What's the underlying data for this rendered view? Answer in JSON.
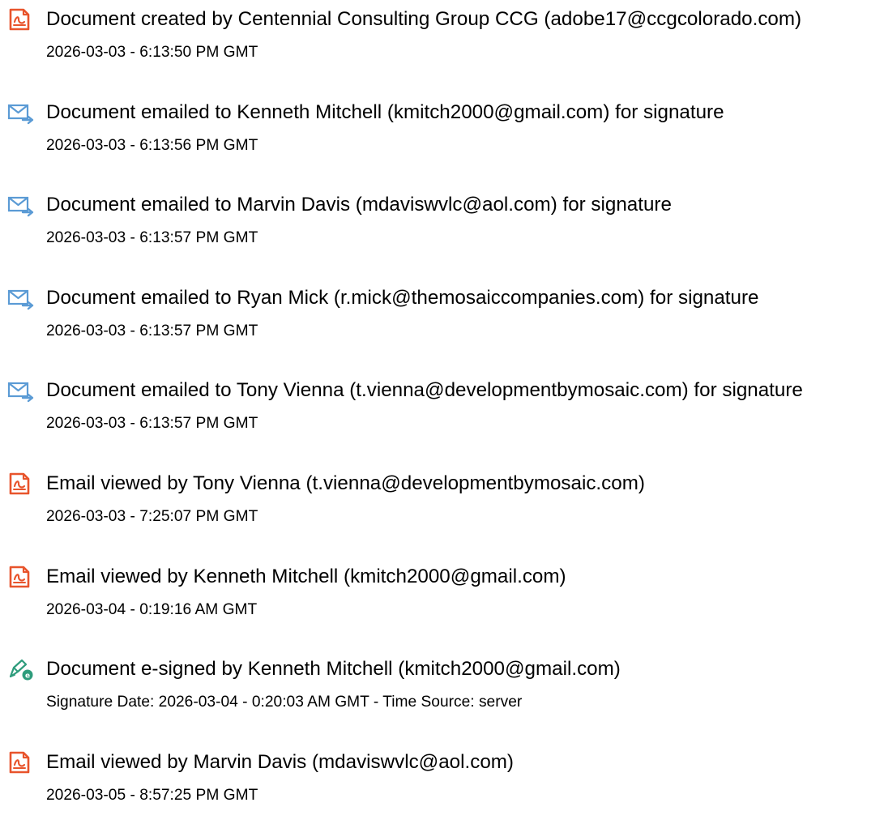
{
  "colors": {
    "document_icon": "#e8542c",
    "email_icon": "#5b9bd5",
    "signed_icon": "#2e9c7c",
    "text": "#000000"
  },
  "events": [
    {
      "icon": "document-icon",
      "title": "Document created by Centennial Consulting Group CCG (adobe17@ccgcolorado.com)",
      "detail": "2026-03-03 - 6:13:50 PM GMT"
    },
    {
      "icon": "email-send-icon",
      "title": "Document emailed to Kenneth Mitchell (kmitch2000@gmail.com) for signature",
      "detail": "2026-03-03 - 6:13:56 PM GMT"
    },
    {
      "icon": "email-send-icon",
      "title": "Document emailed to Marvin Davis (mdaviswvlc@aol.com) for signature",
      "detail": "2026-03-03 - 6:13:57 PM GMT"
    },
    {
      "icon": "email-send-icon",
      "title": "Document emailed to Ryan Mick (r.mick@themosaiccompanies.com) for signature",
      "detail": "2026-03-03 - 6:13:57 PM GMT"
    },
    {
      "icon": "email-send-icon",
      "title": "Document emailed to Tony Vienna (t.vienna@developmentbymosaic.com) for signature",
      "detail": "2026-03-03 - 6:13:57 PM GMT"
    },
    {
      "icon": "document-icon",
      "title": "Email viewed by Tony Vienna (t.vienna@developmentbymosaic.com)",
      "detail": "2026-03-03 - 7:25:07 PM GMT"
    },
    {
      "icon": "document-icon",
      "title": "Email viewed by Kenneth Mitchell (kmitch2000@gmail.com)",
      "detail": "2026-03-04 - 0:19:16 AM GMT"
    },
    {
      "icon": "signature-pen-icon",
      "title": "Document e-signed by Kenneth Mitchell (kmitch2000@gmail.com)",
      "detail": "Signature Date: 2026-03-04 - 0:20:03 AM GMT - Time Source: server"
    },
    {
      "icon": "document-icon",
      "title": "Email viewed by Marvin Davis (mdaviswvlc@aol.com)",
      "detail": "2026-03-05 - 8:57:25 PM GMT"
    }
  ]
}
